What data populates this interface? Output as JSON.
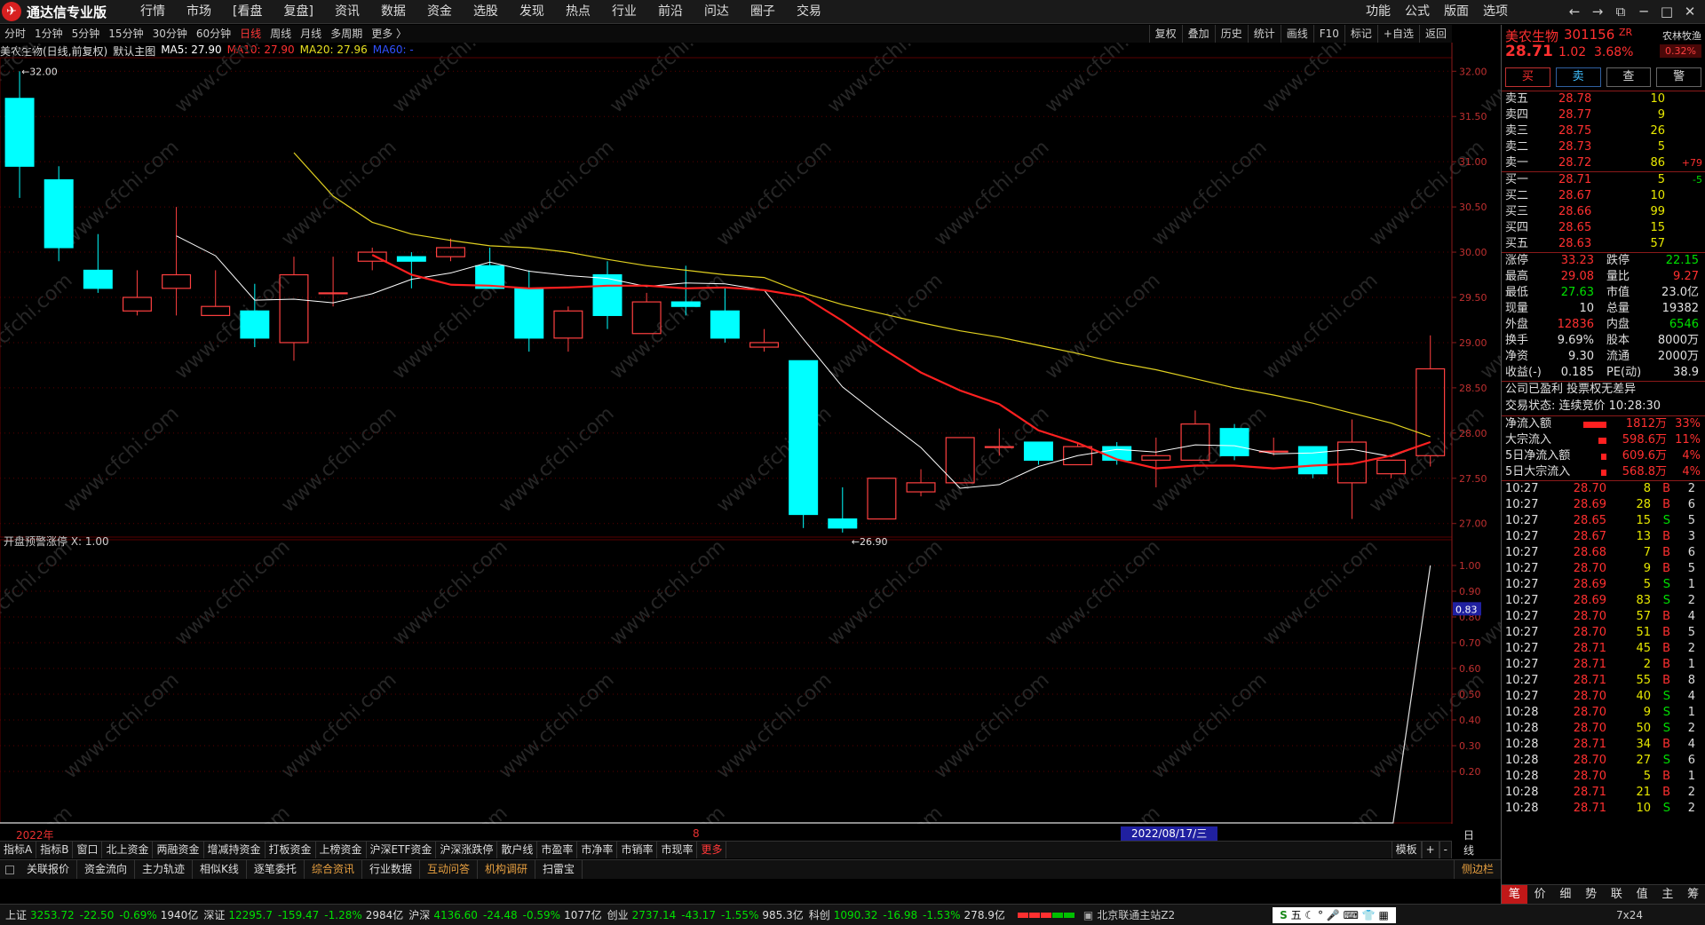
{
  "app": {
    "logo_icon": "tdx-logo-icon",
    "title": "通达信专业版"
  },
  "menu": [
    "行情",
    "市场",
    "[看盘",
    "复盘]",
    "资讯",
    "数据",
    "资金",
    "选股",
    "发现",
    "热点",
    "行业",
    "前沿",
    "问达",
    "圈子",
    "交易"
  ],
  "right_menu": [
    "功能",
    "公式",
    "版面",
    "选项"
  ],
  "window_buttons": [
    "back-arrow-icon",
    "forward-arrow-icon",
    "restore-icon",
    "minimize-icon",
    "maximize-icon",
    "close-icon"
  ],
  "periods": [
    "分时",
    "1分钟",
    "5分钟",
    "15分钟",
    "30分钟",
    "60分钟",
    "日线",
    "周线",
    "月线",
    "多周期",
    "更多 〉"
  ],
  "active_period": "日线",
  "chart_tools": [
    "复权",
    "叠加",
    "历史",
    "统计",
    "画线",
    "F10",
    "标记",
    "+自选",
    "返回"
  ],
  "main_header": {
    "name": "美农生物(日线,前复权)",
    "template": "默认主图",
    "ma5": "MA5: 27.90",
    "ma10": "MA10: 27.90",
    "ma20": "MA20: 27.96",
    "ma60": "MA60: -"
  },
  "colors": {
    "up": "#ff4040",
    "down": "#00ffff",
    "ma5": "#ffffff",
    "ma10": "#ff2020",
    "ma20": "#e0d020",
    "ma60": "#2040ff",
    "grid": "#5a0000"
  },
  "chart_data": [
    {
      "type": "candlestick",
      "title": "美农生物(日线,前复权)",
      "ylim": [
        26.85,
        32.15
      ],
      "y_ticks": [
        32.0,
        31.5,
        31.0,
        30.5,
        30.0,
        29.5,
        29.0,
        28.5,
        28.0,
        27.5,
        27.0
      ],
      "high_label": "32.00",
      "low_label": "26.90",
      "candles": [
        {
          "o": 31.7,
          "h": 32.0,
          "l": 30.6,
          "c": 30.95
        },
        {
          "o": 30.8,
          "h": 30.95,
          "l": 29.9,
          "c": 30.05
        },
        {
          "o": 29.8,
          "h": 30.2,
          "l": 29.55,
          "c": 29.6
        },
        {
          "o": 29.35,
          "h": 29.8,
          "l": 29.3,
          "c": 29.5
        },
        {
          "o": 29.6,
          "h": 30.5,
          "l": 29.3,
          "c": 29.75
        },
        {
          "o": 29.3,
          "h": 29.8,
          "l": 29.3,
          "c": 29.4
        },
        {
          "o": 29.35,
          "h": 29.65,
          "l": 28.95,
          "c": 29.05
        },
        {
          "o": 29.0,
          "h": 29.95,
          "l": 28.8,
          "c": 29.75
        },
        {
          "o": 29.55,
          "h": 29.95,
          "l": 29.4,
          "c": 29.55
        },
        {
          "o": 29.9,
          "h": 30.05,
          "l": 29.8,
          "c": 30.0
        },
        {
          "o": 29.95,
          "h": 30.0,
          "l": 29.6,
          "c": 29.9
        },
        {
          "o": 29.95,
          "h": 30.15,
          "l": 29.9,
          "c": 30.05
        },
        {
          "o": 29.85,
          "h": 30.05,
          "l": 29.6,
          "c": 29.6
        },
        {
          "o": 29.6,
          "h": 29.8,
          "l": 28.9,
          "c": 29.05
        },
        {
          "o": 29.05,
          "h": 29.4,
          "l": 28.9,
          "c": 29.35
        },
        {
          "o": 29.75,
          "h": 29.9,
          "l": 29.15,
          "c": 29.3
        },
        {
          "o": 29.1,
          "h": 29.55,
          "l": 29.1,
          "c": 29.45
        },
        {
          "o": 29.45,
          "h": 29.85,
          "l": 29.3,
          "c": 29.4
        },
        {
          "o": 29.35,
          "h": 29.6,
          "l": 29.0,
          "c": 29.05
        },
        {
          "o": 28.95,
          "h": 29.15,
          "l": 28.9,
          "c": 29.0
        },
        {
          "o": 28.8,
          "h": 28.8,
          "l": 26.95,
          "c": 27.1
        },
        {
          "o": 27.05,
          "h": 27.4,
          "l": 26.9,
          "c": 26.95
        },
        {
          "o": 27.05,
          "h": 27.5,
          "l": 27.05,
          "c": 27.5
        },
        {
          "o": 27.35,
          "h": 27.6,
          "l": 27.3,
          "c": 27.45
        },
        {
          "o": 27.45,
          "h": 27.95,
          "l": 27.45,
          "c": 27.95
        },
        {
          "o": 27.85,
          "h": 28.05,
          "l": 27.75,
          "c": 27.85
        },
        {
          "o": 27.9,
          "h": 27.9,
          "l": 27.65,
          "c": 27.7
        },
        {
          "o": 27.65,
          "h": 27.9,
          "l": 27.65,
          "c": 27.85
        },
        {
          "o": 27.85,
          "h": 27.9,
          "l": 27.65,
          "c": 27.7
        },
        {
          "o": 27.7,
          "h": 27.95,
          "l": 27.4,
          "c": 27.75
        },
        {
          "o": 27.7,
          "h": 28.25,
          "l": 27.7,
          "c": 28.1
        },
        {
          "o": 28.05,
          "h": 28.1,
          "l": 27.7,
          "c": 27.75
        },
        {
          "o": 27.8,
          "h": 27.95,
          "l": 27.75,
          "c": 27.8
        },
        {
          "o": 27.85,
          "h": 27.85,
          "l": 27.5,
          "c": 27.55
        },
        {
          "o": 27.45,
          "h": 28.15,
          "l": 27.05,
          "c": 27.9
        },
        {
          "o": 27.55,
          "h": 27.7,
          "l": 27.5,
          "c": 27.7
        },
        {
          "o": 27.75,
          "h": 29.08,
          "l": 27.63,
          "c": 28.71
        }
      ],
      "series": [
        {
          "name": "MA5",
          "values": [
            null,
            null,
            null,
            null,
            30.18,
            29.96,
            29.47,
            29.48,
            29.44,
            29.54,
            29.7,
            29.77,
            29.89,
            29.79,
            29.74,
            29.71,
            29.62,
            29.66,
            29.65,
            29.58,
            29.04,
            28.51,
            28.17,
            27.84,
            27.39,
            27.43,
            27.63,
            27.75,
            27.82,
            27.79,
            27.87,
            27.86,
            27.77,
            27.78,
            27.82,
            27.74,
            27.9
          ]
        },
        {
          "name": "MA10",
          "values": [
            null,
            null,
            null,
            null,
            null,
            null,
            null,
            null,
            null,
            29.97,
            29.75,
            29.64,
            29.63,
            29.6,
            29.61,
            29.63,
            29.63,
            29.6,
            29.61,
            29.58,
            29.51,
            29.24,
            28.94,
            28.67,
            28.47,
            28.32,
            28.03,
            27.89,
            27.71,
            27.61,
            27.64,
            27.64,
            27.61,
            27.64,
            27.66,
            27.75,
            27.9
          ]
        },
        {
          "name": "MA20",
          "values": [
            null,
            null,
            null,
            null,
            null,
            null,
            null,
            31.1,
            30.62,
            30.33,
            30.2,
            30.13,
            30.07,
            30.05,
            30.0,
            29.92,
            29.85,
            29.8,
            29.75,
            29.72,
            29.55,
            29.42,
            29.32,
            29.22,
            29.13,
            29.06,
            28.97,
            28.88,
            28.78,
            28.7,
            28.6,
            28.5,
            28.42,
            28.33,
            28.22,
            28.11,
            27.96
          ]
        }
      ]
    },
    {
      "type": "line",
      "title": "开盘预警涨停",
      "ylim": [
        0,
        1.1
      ],
      "y_ticks": [
        1.0,
        0.9,
        0.8,
        0.7,
        0.6,
        0.5,
        0.4,
        0.3,
        0.2
      ],
      "series": [
        {
          "name": "开盘预警涨停",
          "values": [
            0,
            0,
            0,
            0,
            0,
            0,
            0,
            0,
            0,
            0,
            0,
            0,
            0,
            0,
            0,
            0,
            0,
            0,
            0,
            0,
            0,
            0,
            0,
            0,
            0,
            0,
            0,
            0,
            0,
            0,
            0,
            0,
            0,
            0,
            0,
            0,
            1
          ]
        }
      ]
    }
  ],
  "sub_header": "开盘预警涨停 X: 1.00",
  "sub_cursor_value": "0.83",
  "date_bar": {
    "year": "2022年",
    "mark": "8",
    "cursor_date": "2022/08/17/三",
    "period": "日线"
  },
  "bottom_tabs1": [
    "指标A",
    "指标B",
    "窗口",
    "北上资金",
    "两融资金",
    "增减持资金",
    "打板资金",
    "上榜资金",
    "沪深ETF资金",
    "沪深涨跌停",
    "散户线",
    "市盈率",
    "市净率",
    "市销率",
    "市现率",
    "更多"
  ],
  "bottom_tabs1_right": [
    "模板",
    "+",
    "-"
  ],
  "bottom_tabs2": [
    "关联报价",
    "资金流向",
    "主力轨迹",
    "相似K线",
    "逐笔委托",
    "综合资讯",
    "行业数据",
    "互动问答",
    "机构调研",
    "扫雷宝"
  ],
  "bottom_tabs2_highlight": [
    "综合资讯",
    "互动问答",
    "机构调研"
  ],
  "side_toggle": "侧边栏",
  "stock": {
    "name": "美农生物",
    "code": "301156",
    "tag": "ZR",
    "sector": "农林牧渔",
    "price": "28.71",
    "change": "1.02",
    "pct": "3.68%",
    "sector_pct": "0.32%"
  },
  "trade_buttons": [
    "买",
    "卖",
    "查",
    "警"
  ],
  "asks": [
    {
      "lbl": "卖五",
      "p": "28.78",
      "v": "10",
      "d": ""
    },
    {
      "lbl": "卖四",
      "p": "28.77",
      "v": "9",
      "d": ""
    },
    {
      "lbl": "卖三",
      "p": "28.75",
      "v": "26",
      "d": ""
    },
    {
      "lbl": "卖二",
      "p": "28.73",
      "v": "5",
      "d": ""
    },
    {
      "lbl": "卖一",
      "p": "28.72",
      "v": "86",
      "d": "+79"
    }
  ],
  "bids": [
    {
      "lbl": "买一",
      "p": "28.71",
      "v": "5",
      "d": "-5"
    },
    {
      "lbl": "买二",
      "p": "28.67",
      "v": "10",
      "d": ""
    },
    {
      "lbl": "买三",
      "p": "28.66",
      "v": "99",
      "d": ""
    },
    {
      "lbl": "买四",
      "p": "28.65",
      "v": "15",
      "d": ""
    },
    {
      "lbl": "买五",
      "p": "28.63",
      "v": "57",
      "d": ""
    }
  ],
  "stats": [
    {
      "l1": "涨停",
      "v1": "33.23",
      "c1": "up",
      "l2": "跌停",
      "v2": "22.15",
      "c2": "dn"
    },
    {
      "l1": "最高",
      "v1": "29.08",
      "c1": "up",
      "l2": "量比",
      "v2": "9.27",
      "c2": "up"
    },
    {
      "l1": "最低",
      "v1": "27.63",
      "c1": "dn",
      "l2": "市值",
      "v2": "23.0亿",
      "c2": "wh"
    },
    {
      "l1": "现量",
      "v1": "10",
      "c1": "wh",
      "l2": "总量",
      "v2": "19382",
      "c2": "wh"
    },
    {
      "l1": "外盘",
      "v1": "12836",
      "c1": "up",
      "l2": "内盘",
      "v2": "6546",
      "c2": "dn"
    },
    {
      "l1": "换手",
      "v1": "9.69%",
      "c1": "wh",
      "l2": "股本",
      "v2": "8000万",
      "c2": "wh"
    },
    {
      "l1": "净资",
      "v1": "9.30",
      "c1": "wh",
      "l2": "流通",
      "v2": "2000万",
      "c2": "wh"
    },
    {
      "l1": "收益(-)",
      "v1": "0.185",
      "c1": "wh",
      "l2": "PE(动)",
      "v2": "38.9",
      "c2": "wh"
    }
  ],
  "notes": [
    "公司已盈利 投票权无差异",
    "交易状态: 连续竞价 10:28:30"
  ],
  "flows": [
    {
      "l": "净流入额",
      "v": "1812万",
      "p": "33%",
      "bar": 0.33
    },
    {
      "l": "大宗流入",
      "v": "598.6万",
      "p": "11%",
      "bar": 0.11
    },
    {
      "l": "5日净流入额",
      "v": "609.6万",
      "p": "4%",
      "bar": 0.04
    },
    {
      "l": "5日大宗流入",
      "v": "568.8万",
      "p": "4%",
      "bar": 0.04
    }
  ],
  "ticks": [
    {
      "t": "10:27",
      "p": "28.70",
      "v": "8",
      "s": "B",
      "n": "2"
    },
    {
      "t": "10:27",
      "p": "28.69",
      "v": "28",
      "s": "B",
      "n": "6"
    },
    {
      "t": "10:27",
      "p": "28.65",
      "v": "15",
      "s": "S",
      "n": "5"
    },
    {
      "t": "10:27",
      "p": "28.67",
      "v": "13",
      "s": "B",
      "n": "3"
    },
    {
      "t": "10:27",
      "p": "28.68",
      "v": "7",
      "s": "B",
      "n": "6"
    },
    {
      "t": "10:27",
      "p": "28.70",
      "v": "9",
      "s": "B",
      "n": "5"
    },
    {
      "t": "10:27",
      "p": "28.69",
      "v": "5",
      "s": "S",
      "n": "1"
    },
    {
      "t": "10:27",
      "p": "28.69",
      "v": "83",
      "s": "S",
      "n": "2"
    },
    {
      "t": "10:27",
      "p": "28.70",
      "v": "57",
      "s": "B",
      "n": "4"
    },
    {
      "t": "10:27",
      "p": "28.70",
      "v": "51",
      "s": "B",
      "n": "5"
    },
    {
      "t": "10:27",
      "p": "28.71",
      "v": "45",
      "s": "B",
      "n": "2"
    },
    {
      "t": "10:27",
      "p": "28.71",
      "v": "2",
      "s": "B",
      "n": "1"
    },
    {
      "t": "10:27",
      "p": "28.71",
      "v": "55",
      "s": "B",
      "n": "8"
    },
    {
      "t": "10:27",
      "p": "28.70",
      "v": "40",
      "s": "S",
      "n": "4"
    },
    {
      "t": "10:28",
      "p": "28.70",
      "v": "9",
      "s": "S",
      "n": "1"
    },
    {
      "t": "10:28",
      "p": "28.70",
      "v": "50",
      "s": "S",
      "n": "2"
    },
    {
      "t": "10:28",
      "p": "28.71",
      "v": "34",
      "s": "B",
      "n": "4"
    },
    {
      "t": "10:28",
      "p": "28.70",
      "v": "27",
      "s": "S",
      "n": "6"
    },
    {
      "t": "10:28",
      "p": "28.70",
      "v": "5",
      "s": "B",
      "n": "1"
    },
    {
      "t": "10:28",
      "p": "28.71",
      "v": "21",
      "s": "B",
      "n": "2"
    },
    {
      "t": "10:28",
      "p": "28.71",
      "v": "10",
      "s": "S",
      "n": "2"
    }
  ],
  "right_tabs": [
    "笔",
    "价",
    "细",
    "势",
    "联",
    "值",
    "主",
    "筹"
  ],
  "right_tab_active": "笔",
  "status": [
    {
      "n": "上证",
      "p": "3253.72",
      "c": "-22.50",
      "pc": "-0.69%",
      "a": "1940亿"
    },
    {
      "n": "深证",
      "p": "12295.7",
      "c": "-159.47",
      "pc": "-1.28%",
      "a": "2984亿"
    },
    {
      "n": "沪深",
      "p": "4136.60",
      "c": "-24.48",
      "pc": "-0.59%",
      "a": "1077亿"
    },
    {
      "n": "创业",
      "p": "2737.14",
      "c": "-43.17",
      "pc": "-1.55%",
      "a": "985.3亿"
    },
    {
      "n": "科创",
      "p": "1090.32",
      "c": "-16.98",
      "pc": "-1.53%",
      "a": "278.9亿"
    }
  ],
  "server": "北京联通主站Z2",
  "ime": "五",
  "clock_label": "7x24",
  "watermark": "www.cfchi.com"
}
